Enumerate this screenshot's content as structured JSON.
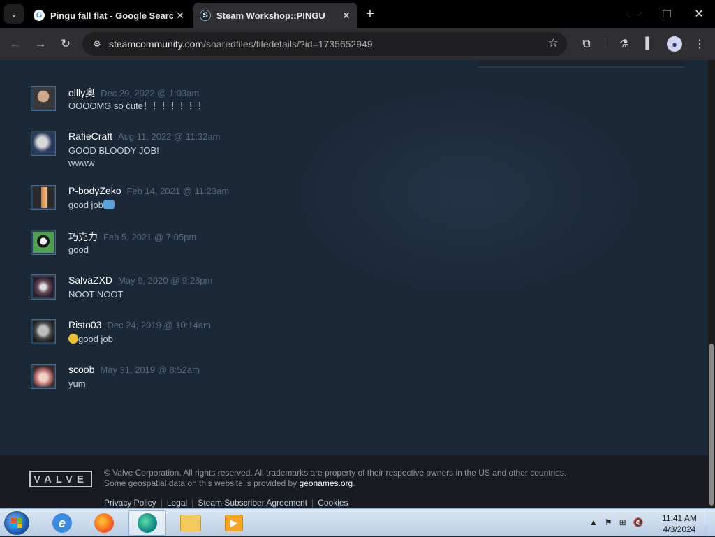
{
  "browser": {
    "tabs": [
      {
        "title": "Pingu fall flat - Google Search",
        "favicon": "google-icon",
        "active": false
      },
      {
        "title": "Steam Workshop::PINGU",
        "favicon": "steam-icon",
        "active": true
      }
    ],
    "url": {
      "host": "steamcommunity.com",
      "path": "/sharedfiles/filedetails/?id=1735652949"
    },
    "icons": {
      "back": "←",
      "forward": "→",
      "reload": "↻",
      "star": "☆",
      "site_info": "⚙",
      "extensions": "⧉",
      "labs": "⚗",
      "sidebar": "▌",
      "profile": "●",
      "menu": "⋮",
      "tab_menu": "⌄",
      "close": "✕",
      "new_tab": "+",
      "minimize": "—",
      "restore": "❐",
      "window_close": "✕"
    }
  },
  "comments": [
    {
      "author": "ollly奥",
      "time": "Dec 29, 2022 @ 1:03am",
      "text": "OOOOMG so cute！！！！！！！",
      "avatar_colors": [
        "#cfa68a",
        "#3a3a3a"
      ]
    },
    {
      "author": "RafieCraft",
      "time": "Aug 11, 2022 @ 11:32am",
      "text": "GOOD BLOODY JOB!\nwwww",
      "avatar_colors": [
        "#d8d8d8",
        "#2a3a5a"
      ]
    },
    {
      "author": "P-bodyZeko",
      "time": "Feb 14, 2021 @ 11:23am",
      "text": "good job",
      "emoji_after": "thumbs-up-emoji",
      "avatar_colors": [
        "#d98a3a",
        "#2a2a2a"
      ]
    },
    {
      "author": "巧克力",
      "time": "Feb 5, 2021 @ 7:05pm",
      "text": "good",
      "avatar_colors": [
        "#2f6aa8",
        "#f2f2f2"
      ]
    },
    {
      "author": "SalvaZXD",
      "time": "May 9, 2020 @ 9:28pm",
      "text": "NOOT NOOT",
      "avatar_colors": [
        "#6a4a5a",
        "#e0e0e0"
      ]
    },
    {
      "author": "Risto03",
      "time": "Dec 24, 2019 @ 10:14am",
      "text": "good job",
      "emoji_before": "face-emoji",
      "avatar_colors": [
        "#4a4a4a",
        "#bdbdbd"
      ]
    },
    {
      "author": "scoob",
      "time": "May 31, 2019 @ 8:52am",
      "text": "yum",
      "avatar_colors": [
        "#c87a7a",
        "#3a2a2a"
      ]
    }
  ],
  "footer": {
    "logo_text": "VALVE",
    "line1": "© Valve Corporation. All rights reserved. All trademarks are property of their respective owners in the US and other countries.",
    "line2_prefix": "Some geospatial data on this website is provided by ",
    "line2_link": "geonames.org",
    "line2_suffix": ".",
    "links": [
      "Privacy Policy",
      "Legal",
      "Steam Subscriber Agreement",
      "Cookies"
    ]
  },
  "taskbar": {
    "apps": [
      "internet-explorer-icon",
      "firefox-icon",
      "edge-icon",
      "file-explorer-icon",
      "media-player-icon"
    ],
    "clock_time": "11:41 AM",
    "clock_date": "4/3/2024",
    "tray_icons": {
      "arrow": "▲",
      "flag": "⚑",
      "network": "⊞",
      "volume": "🔇"
    }
  },
  "colors": {
    "page_bg": "#1b2838",
    "footer_bg": "#171a21",
    "timestamp": "#566a80",
    "comment_text": "#c6d4df"
  }
}
